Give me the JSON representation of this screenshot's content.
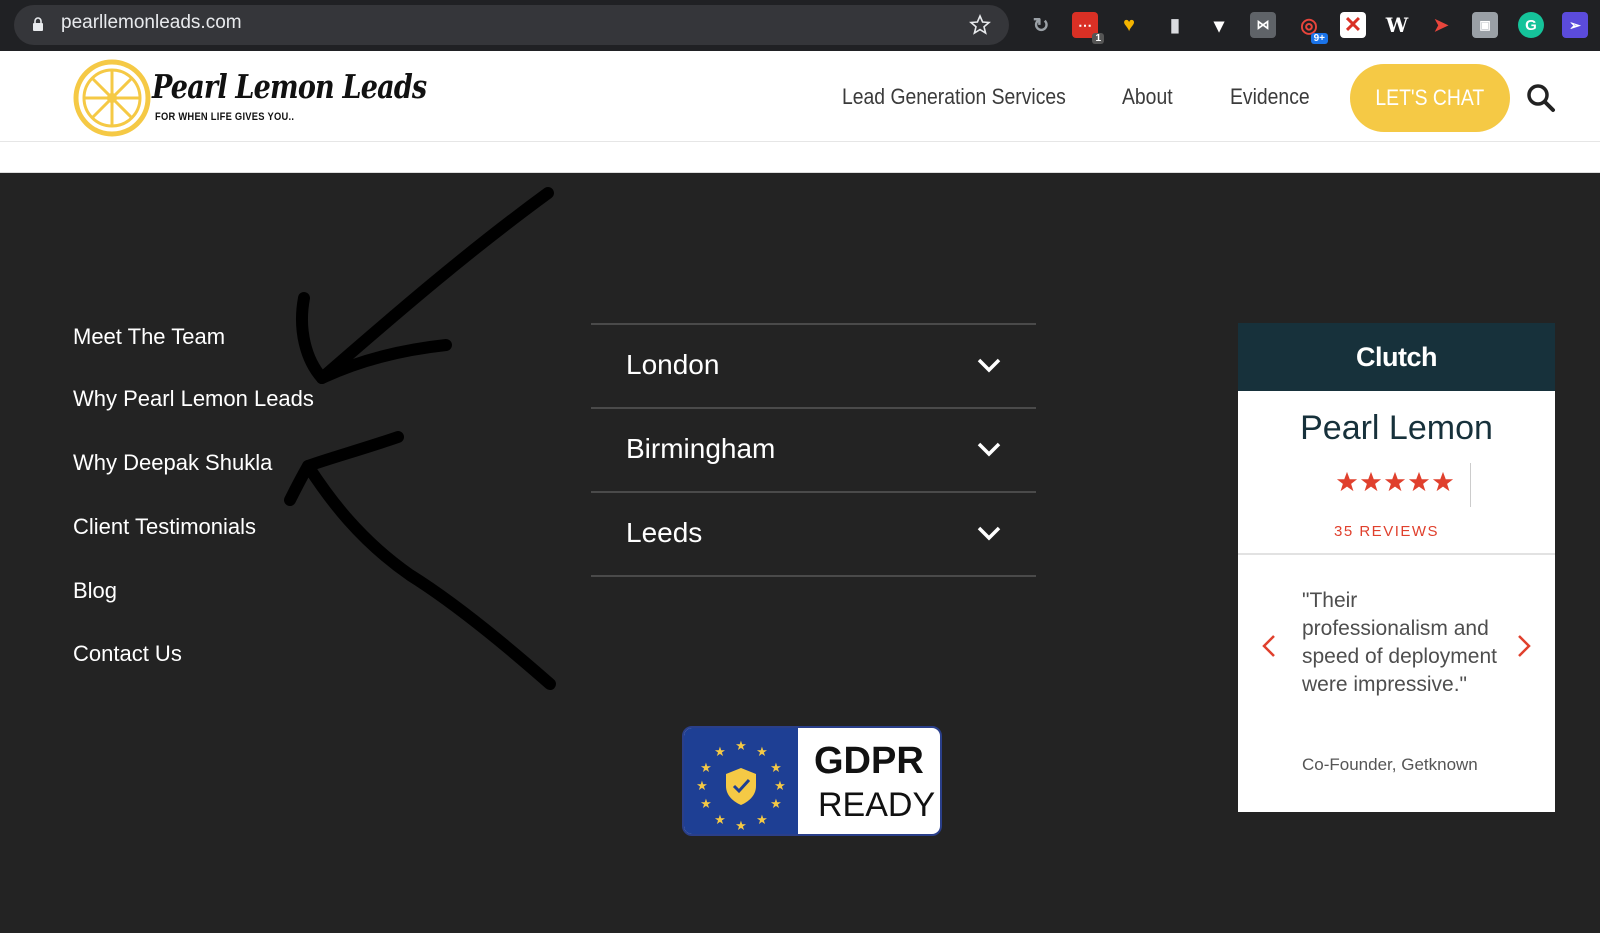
{
  "browser": {
    "url": "pearllemonleads.com",
    "extensions": [
      {
        "icon": "refresh-c-icon",
        "badge": ""
      },
      {
        "icon": "calendar-ext-icon",
        "badge": "1"
      },
      {
        "icon": "heart-ext-icon",
        "badge": ""
      },
      {
        "icon": "book-ext-icon",
        "badge": ""
      },
      {
        "icon": "diamond-ext-icon",
        "badge": ""
      },
      {
        "icon": "butterfly-ext-icon",
        "badge": ""
      },
      {
        "icon": "radar-ext-icon",
        "badge": "9+"
      },
      {
        "icon": "x-ext-icon",
        "badge": ""
      },
      {
        "icon": "w-ext-icon",
        "badge": ""
      },
      {
        "icon": "bird-ext-icon",
        "badge": ""
      },
      {
        "icon": "gray-ext-icon",
        "badge": ""
      },
      {
        "icon": "grammarly-icon",
        "badge": ""
      },
      {
        "icon": "pointer-ext-icon",
        "badge": ""
      }
    ]
  },
  "header": {
    "logo_name": "Pearl Lemon Leads",
    "logo_tagline": "FOR WHEN LIFE GIVES YOU..",
    "nav": [
      "Lead Generation Services",
      "About",
      "Evidence"
    ],
    "cta": "LET'S CHAT"
  },
  "footer": {
    "links": [
      "Meet The Team",
      "Why Pearl Lemon Leads",
      "Why Deepak Shukla",
      "Client Testimonials",
      "Blog",
      "Contact Us"
    ],
    "locations": [
      "London",
      "Birmingham",
      "Leeds"
    ],
    "gdpr": {
      "line1": "GDPR",
      "line2": "READY"
    }
  },
  "clutch": {
    "brand": "Clutch",
    "company": "Pearl Lemon",
    "rating": 5,
    "reviews": "35 REVIEWS",
    "quote": "\"Their professionalism and speed of deployment were impressive.\"",
    "author": "Co-Founder, Getknown"
  },
  "colors": {
    "accent_yellow": "#f5c945",
    "footer_bg": "#232323",
    "clutch_dark": "#17313b",
    "clutch_red": "#e0402d"
  }
}
